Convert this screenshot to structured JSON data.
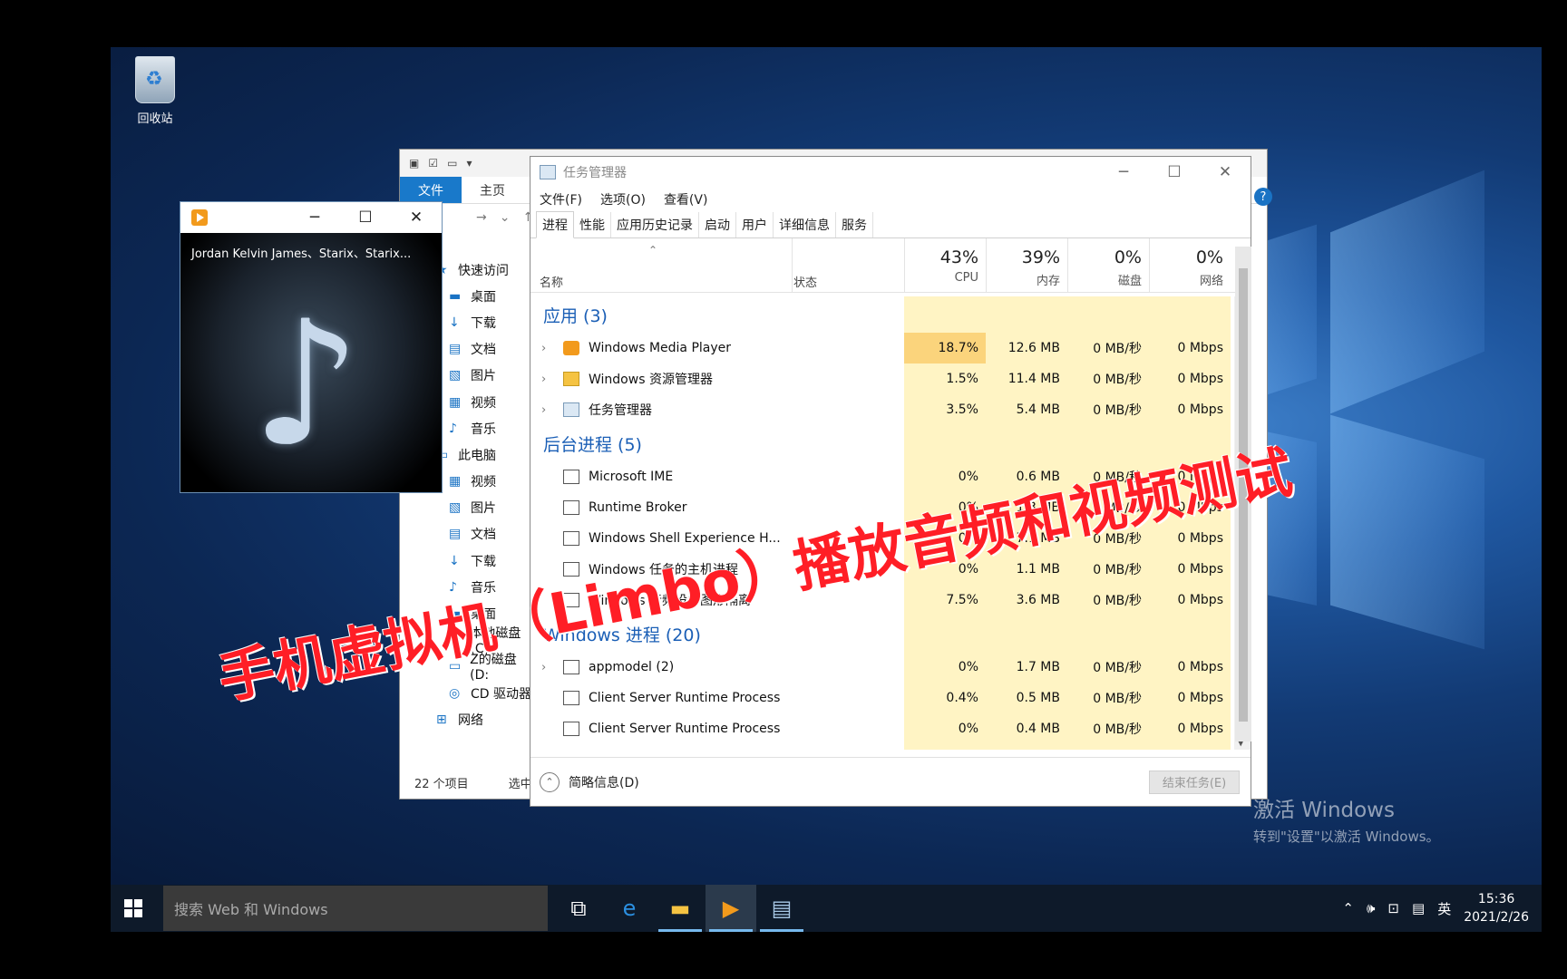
{
  "desktop": {
    "recycle_bin_label": "回收站",
    "activate_line1": "激活 Windows",
    "activate_line2": "转到\"设置\"以激活 Windows。"
  },
  "explorer": {
    "file_tab": "文件",
    "home_tab": "主页",
    "tree": [
      {
        "label": "快速访问",
        "icon": "star-icon",
        "sec": false
      },
      {
        "label": "桌面",
        "icon": "desktop-icon",
        "sec": true
      },
      {
        "label": "下载",
        "icon": "download-icon",
        "sec": true
      },
      {
        "label": "文档",
        "icon": "document-icon",
        "sec": true
      },
      {
        "label": "图片",
        "icon": "picture-icon",
        "sec": true
      },
      {
        "label": "视频",
        "icon": "video-icon",
        "sec": true
      },
      {
        "label": "音乐",
        "icon": "music-icon",
        "sec": true
      },
      {
        "label": "此电脑",
        "icon": "pc-icon",
        "sec": false
      },
      {
        "label": "视频",
        "icon": "video-icon",
        "sec": true
      },
      {
        "label": "图片",
        "icon": "picture-icon",
        "sec": true
      },
      {
        "label": "文档",
        "icon": "document-icon",
        "sec": true
      },
      {
        "label": "下载",
        "icon": "download-icon",
        "sec": true
      },
      {
        "label": "音乐",
        "icon": "music-icon",
        "sec": true
      },
      {
        "label": "桌面",
        "icon": "desktop-icon",
        "sec": true
      },
      {
        "label": "本地磁盘 (C",
        "icon": "disk-icon",
        "sec": true
      },
      {
        "label": "Z的磁盘 (D:",
        "icon": "disk-icon",
        "sec": true
      },
      {
        "label": "CD 驱动器",
        "icon": "cd-icon",
        "sec": true
      },
      {
        "label": "网络",
        "icon": "network-icon",
        "sec": false
      }
    ],
    "item_count": "22 个项目",
    "selected": "选中"
  },
  "media_player": {
    "track": "Jordan Kelvin James、Starix、Starix..."
  },
  "task_manager": {
    "title": "任务管理器",
    "menu": [
      "文件(F)",
      "选项(O)",
      "查看(V)"
    ],
    "tabs": [
      "进程",
      "性能",
      "应用历史记录",
      "启动",
      "用户",
      "详细信息",
      "服务"
    ],
    "columns": {
      "name": "名称",
      "status": "状态",
      "cpu_pct": "43%",
      "cpu_label": "CPU",
      "mem_pct": "39%",
      "mem_label": "内存",
      "disk_pct": "0%",
      "disk_label": "磁盘",
      "net_pct": "0%",
      "net_label": "网络"
    },
    "groups": [
      {
        "title": "应用 (3)",
        "rows": [
          {
            "name": "Windows Media Player",
            "expandable": true,
            "icon": "wmp",
            "cpu": "18.7%",
            "mem": "12.6 MB",
            "disk": "0 MB/秒",
            "net": "0 Mbps",
            "hot": true
          },
          {
            "name": "Windows 资源管理器",
            "expandable": true,
            "icon": "explorer",
            "cpu": "1.5%",
            "mem": "11.4 MB",
            "disk": "0 MB/秒",
            "net": "0 Mbps",
            "hot": false
          },
          {
            "name": "任务管理器",
            "expandable": true,
            "icon": "taskmgr",
            "cpu": "3.5%",
            "mem": "5.4 MB",
            "disk": "0 MB/秒",
            "net": "0 Mbps",
            "hot": false
          }
        ]
      },
      {
        "title": "后台进程 (5)",
        "rows": [
          {
            "name": "Microsoft IME",
            "expandable": false,
            "icon": "proc",
            "cpu": "0%",
            "mem": "0.6 MB",
            "disk": "0 MB/秒",
            "net": "0 Mbps",
            "hot": false
          },
          {
            "name": "Runtime Broker",
            "expandable": false,
            "icon": "proc",
            "cpu": "0%",
            "mem": "1.3 MB",
            "disk": "0 MB/秒",
            "net": "0 Mbps",
            "hot": false
          },
          {
            "name": "Windows Shell Experience H...",
            "expandable": false,
            "icon": "proc",
            "cpu": "0%",
            "mem": "7.1 MB",
            "disk": "0 MB/秒",
            "net": "0 Mbps",
            "hot": false
          },
          {
            "name": "Windows 任务的主机进程",
            "expandable": false,
            "icon": "proc",
            "cpu": "0%",
            "mem": "1.1 MB",
            "disk": "0 MB/秒",
            "net": "0 Mbps",
            "hot": false
          },
          {
            "name": "Windows 音频设备图形隔离",
            "expandable": false,
            "icon": "proc",
            "cpu": "7.5%",
            "mem": "3.6 MB",
            "disk": "0 MB/秒",
            "net": "0 Mbps",
            "hot": false
          }
        ]
      },
      {
        "title": "Windows 进程 (20)",
        "rows": [
          {
            "name": "appmodel (2)",
            "expandable": true,
            "icon": "proc",
            "cpu": "0%",
            "mem": "1.7 MB",
            "disk": "0 MB/秒",
            "net": "0 Mbps",
            "hot": false
          },
          {
            "name": "Client Server Runtime Process",
            "expandable": false,
            "icon": "proc",
            "cpu": "0.4%",
            "mem": "0.5 MB",
            "disk": "0 MB/秒",
            "net": "0 Mbps",
            "hot": false
          },
          {
            "name": "Client Server Runtime Process",
            "expandable": false,
            "icon": "proc",
            "cpu": "0%",
            "mem": "0.4 MB",
            "disk": "0 MB/秒",
            "net": "0 Mbps",
            "hot": false
          }
        ]
      }
    ],
    "less_details": "简略信息(D)",
    "end_task": "结束任务(E)"
  },
  "caption": "手机虚拟机（Limbo）播放音频和视频测试",
  "taskbar": {
    "search_placeholder": "搜索 Web 和 Windows",
    "ime": "英",
    "time": "15:36",
    "date": "2021/2/26"
  },
  "colors": {
    "accent": "#1979ca",
    "group_title": "#1b5fb6",
    "cpu_hot": "#fbd47c",
    "metric_bg": "#fff4c4",
    "caption": "#ff1e26"
  }
}
